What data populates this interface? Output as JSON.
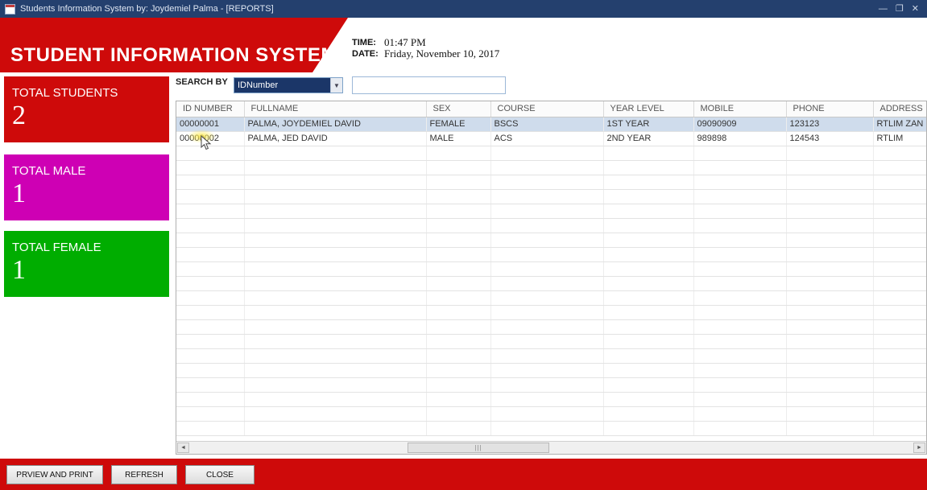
{
  "titlebar": {
    "title": "Students Information System by: Joydemiel Palma - [REPORTS]",
    "minimize_glyph": "—",
    "restore_glyph": "❐",
    "close_glyph": "✕"
  },
  "header": {
    "title": "STUDENT INFORMATION SYSTEM",
    "time_label": "TIME:",
    "time_value": "01:47 PM",
    "date_label": "DATE:",
    "date_value": "Friday, November 10, 2017"
  },
  "stats": [
    {
      "label": "TOTAL STUDENTS",
      "value": "2",
      "color": "#ce0a0a"
    },
    {
      "label": "TOTAL MALE",
      "value": "1",
      "color": "#ce00b4"
    },
    {
      "label": "TOTAL FEMALE",
      "value": "1",
      "color": "#00ad00"
    }
  ],
  "search": {
    "label": "SEARCH BY",
    "dropdown_value": "IDNumber",
    "input_value": ""
  },
  "grid": {
    "columns": [
      "ID NUMBER",
      "FULLNAME",
      "SEX",
      "COURSE",
      "YEAR LEVEL",
      "MOBILE",
      "PHONE",
      "ADDRESS"
    ],
    "rows": [
      [
        "00000001",
        "PALMA, JOYDEMIEL DAVID",
        "FEMALE",
        "BSCS",
        "1ST YEAR",
        "09090909",
        "123123",
        "RTLIM ZAN"
      ],
      [
        "00000002",
        "PALMA, JED DAVID",
        "MALE",
        "ACS",
        "2ND YEAR",
        "989898",
        "124543",
        "RTLIM"
      ]
    ],
    "selected_row_index": 0,
    "scrollbar": {
      "left_arrow": "◄",
      "right_arrow": "►",
      "grip": "|||"
    }
  },
  "footer": {
    "buttons": [
      "PRVIEW AND PRINT",
      "REFRESH",
      "CLOSE"
    ]
  },
  "colors": {
    "titlebar": "#24406e",
    "banner_red": "#ce0a0a",
    "male_magenta": "#ce00b4",
    "female_green": "#00ad00",
    "selected_row": "#cfdcec",
    "dropdown_navy": "#1b3668"
  }
}
